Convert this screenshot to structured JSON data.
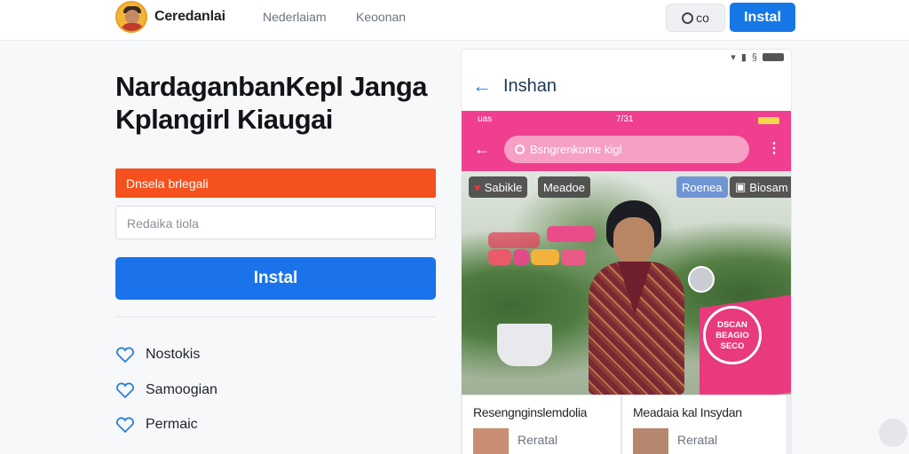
{
  "topbar": {
    "logo_icon": "avatar-logo",
    "brand": "Ceredanlai",
    "nav": [
      "Nederlaiam",
      "Keoonan"
    ],
    "secondary_label": "co",
    "primary_label": "Instal"
  },
  "hero": {
    "title": "NardaganbanKepl Janga Kplangirl Kiaugai",
    "banner": "Dnsela brlegali",
    "input_placeholder": "Redaika tiola",
    "cta": "Instal",
    "features": [
      "Nostokis",
      "Samoogian",
      "Permaic"
    ]
  },
  "phone": {
    "status_icons": [
      "wifi-icon",
      "signal-icon",
      "battery-icon"
    ],
    "title": "Inshan",
    "pink_status_left": "uas",
    "pink_status_center": "7/31",
    "search_placeholder": "Bsngrenkome kigl",
    "chips": [
      "Sabikle",
      "Meadoe",
      "Roenea",
      "Biosam"
    ],
    "badge_text": "DSCAN BEAGIO SECO",
    "cards": [
      {
        "title": "Resengnginslemdolia",
        "sub": "Reratal"
      },
      {
        "title": "Meadaia kal Insydan",
        "sub": "Reratal"
      }
    ]
  },
  "colors": {
    "brand_blue": "#1a73ea",
    "banner_orange": "#f4511e",
    "phone_pink": "#ef3f8e"
  }
}
